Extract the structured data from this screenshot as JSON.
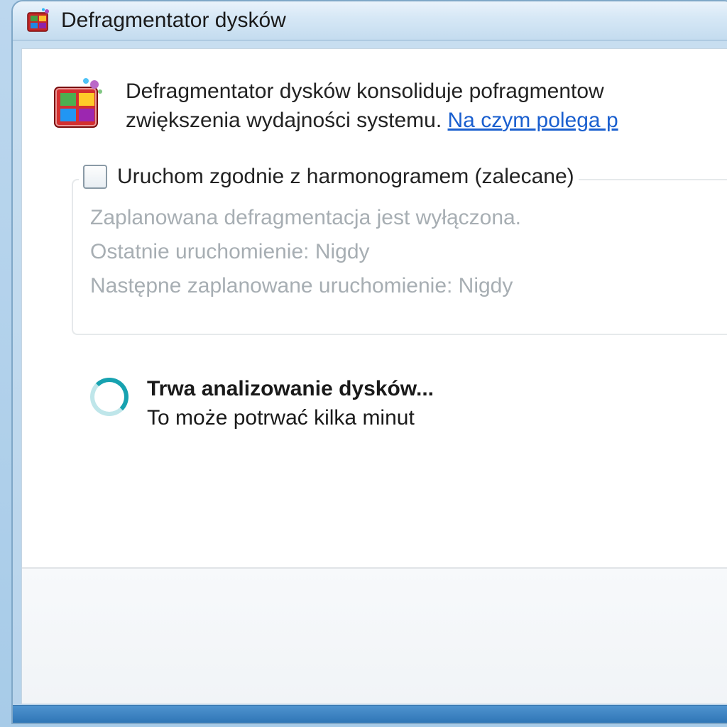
{
  "window": {
    "title": "Defragmentator dysków"
  },
  "intro": {
    "line1": "Defragmentator dysków konsoliduje pofragmentow",
    "line2_prefix": "zwiększenia wydajności systemu. ",
    "link_text": "Na czym polega p"
  },
  "schedule": {
    "checkbox_label": "Uruchom zgodnie z harmonogramem (zalecane)",
    "status_line": "Zaplanowana defragmentacja jest wyłączona.",
    "last_run": "Ostatnie uruchomienie: Nigdy",
    "next_run": "Następne zaplanowane uruchomienie: Nigdy"
  },
  "progress": {
    "title": "Trwa analizowanie dysków...",
    "subtitle": "To może potrwać kilka minut"
  }
}
